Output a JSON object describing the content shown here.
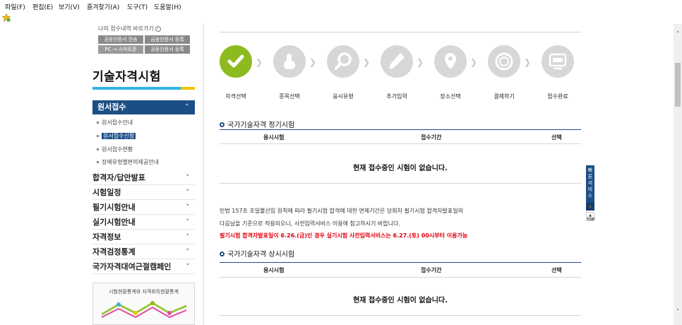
{
  "menubar": {
    "items": [
      "파일(F)",
      "편집(E)",
      "보기(V)",
      "즐겨찾기(A)",
      "도구(T)",
      "도움말(H)"
    ]
  },
  "shortcut": {
    "title": "나의 접수내역 바로가기",
    "btn1": "공동인증서 전송",
    "btn2": "금융인증서 등록",
    "btn3": "PC → 스마트폰",
    "btn4": "공동인증서 등록"
  },
  "sidebar": {
    "title": "기술자격시험",
    "active_menu": "원서접수",
    "sub_items": [
      "원서접수안내",
      "원서접수신청",
      "원서접수현황",
      "장애유형별편의제공안내"
    ],
    "menus": [
      "합격자/답안발표",
      "시험일정",
      "필기시험안내",
      "실기시험안내",
      "자격정보",
      "자격검정통계",
      "국가자격대여근절캠페인"
    ],
    "stat_box_title": "시험현황통계와 자격취득현황통계"
  },
  "steps": [
    "자격선택",
    "종목선택",
    "응시유형",
    "추가입력",
    "장소선택",
    "결제하기",
    "접수완료"
  ],
  "section1": {
    "title": "국가기술자격 정기시험",
    "col1": "응시시험",
    "col2": "접수기간",
    "col3": "선택",
    "empty": "현재 접수중인 시험이 없습니다."
  },
  "notice": {
    "line1": "민법 157조 초일불산입 원칙에 따라 필기시험 합격에 대한 면제기간은 당회차 필기시험 합격자발표일의",
    "line2": "다음날을 기준으로 적용되오니, 사전입력서비스 이용에 참고하시기 바랍니다.",
    "line3": "필기시험 합격자발표일이 6.26.(금)인 경우 실기시험 사전입력서비스는 6.27.(토) 00시부터 이용가능"
  },
  "section2": {
    "title": "국가기술자격 상시시험",
    "col1": "응시시험",
    "col2": "접수기간",
    "col3": "선택",
    "empty": "현재 접수중인 시험이 없습니다."
  },
  "quick": {
    "label": "빠른서비스",
    "top": "TOP"
  },
  "colors": {
    "navy": "#1c4e86",
    "green": "#8dbb1f",
    "red": "#e4000f",
    "cyan": "#35b2e6"
  }
}
